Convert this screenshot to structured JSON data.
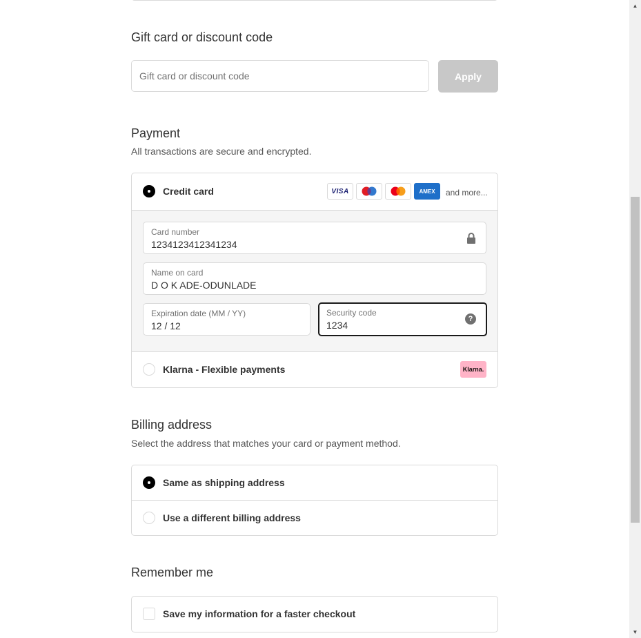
{
  "discount": {
    "title": "Gift card or discount code",
    "placeholder": "Gift card or discount code",
    "apply_label": "Apply"
  },
  "payment": {
    "title": "Payment",
    "subtitle": "All transactions are secure and encrypted.",
    "credit_card": {
      "label": "Credit card",
      "selected": true,
      "logos": [
        "VISA",
        "maestro-icon",
        "mastercard-icon",
        "AMEX"
      ],
      "and_more": "and more...",
      "card_number": {
        "label": "Card number",
        "value": "1234123412341234"
      },
      "name_on_card": {
        "label": "Name on card",
        "value": "D O K ADE-ODUNLADE"
      },
      "expiration": {
        "label": "Expiration date (MM / YY)",
        "value": "12 / 12"
      },
      "security_code": {
        "label": "Security code",
        "value": "1234",
        "help_glyph": "?"
      }
    },
    "klarna": {
      "label": "Klarna - Flexible payments",
      "selected": false,
      "badge": "Klarna."
    }
  },
  "billing": {
    "title": "Billing address",
    "subtitle": "Select the address that matches your card or payment method.",
    "options": [
      {
        "label": "Same as shipping address",
        "selected": true
      },
      {
        "label": "Use a different billing address",
        "selected": false
      }
    ]
  },
  "remember": {
    "title": "Remember me",
    "checkbox_label": "Save my information for a faster checkout",
    "checked": false
  },
  "colors": {
    "border": "#d9d9d9",
    "apply_disabled": "#c8c8c8",
    "amex": "#1e6fc9",
    "klarna": "#ffb3c7",
    "selected_radio": "#000000"
  }
}
